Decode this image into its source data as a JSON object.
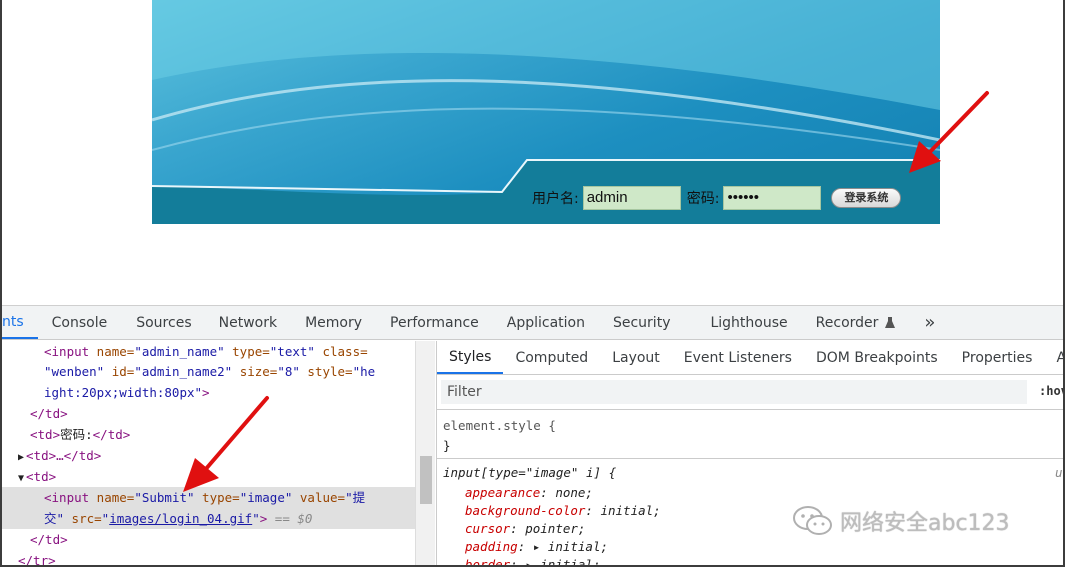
{
  "login": {
    "username_label": "用户名:",
    "username_value": "admin",
    "password_label": "密码:",
    "password_value": "••••••",
    "submit_button": "登录系统"
  },
  "devtools": {
    "tabs": [
      "nts",
      "Console",
      "Sources",
      "Network",
      "Memory",
      "Performance",
      "Application",
      "Security",
      "Lighthouse",
      "Recorder",
      "»"
    ],
    "active_tab": "nts",
    "elements": {
      "l1_tag": "<input",
      "l1_a1": " name=",
      "l1_v1": "\"admin_name\"",
      "l1_a2": " type=",
      "l1_v2": "\"text\"",
      "l1_a3": " class=",
      "l2_v3": "\"wenben\"",
      "l2_a4": " id=",
      "l2_v4": "\"admin_name2\"",
      "l2_a5": " size=",
      "l2_v5": "\"8\"",
      "l2_a6": " style=",
      "l2_v6": "\"he",
      "l3_v6": "ight:20px;width:80px\"",
      "l3_end": ">",
      "l4": "</td>",
      "l5_open": "<td>",
      "l5_text": "密码:",
      "l5_close": "</td>",
      "l6": "<td>…</td>",
      "l7": "<td>",
      "l8_tag": "<input",
      "l8_a1": " name=",
      "l8_v1": "\"Submit\"",
      "l8_a2": " type=",
      "l8_v2": "\"image\"",
      "l8_a3": " value=",
      "l8_v3": "\"提",
      "l9_v3": "交\"",
      "l9_a4": " src=",
      "l9_q1": "\"",
      "l9_link": "images/login_04.gif",
      "l9_q2": "\"",
      "l9_end": ">",
      "l9_eq": " == $0",
      "l10": "</td>",
      "l11": "</tr>"
    },
    "style_tabs": [
      "Styles",
      "Computed",
      "Layout",
      "Event Listeners",
      "DOM Breakpoints",
      "Properties",
      "Acces"
    ],
    "active_style_tab": "Styles",
    "filter_placeholder": "Filter",
    "hov_label": ":hov",
    "element_style": "element.style {",
    "element_style_close": "}",
    "rule_selector": "input[type=\"image\" i] {",
    "rule_source": "u",
    "declarations": [
      {
        "prop": "appearance",
        "value": "none;"
      },
      {
        "prop": "background-color",
        "value": "initial;"
      },
      {
        "prop": "cursor",
        "value": "pointer;"
      },
      {
        "prop": "padding",
        "value": "▸ initial;"
      },
      {
        "prop": "border",
        "value": "▸ initial;"
      }
    ]
  },
  "watermark": "网络安全abc123",
  "colors": {
    "arrow": "#e01010",
    "accent": "#1a73e8",
    "banner_blue": "#1d8fc0",
    "input_bg": "#cfe8c8"
  }
}
